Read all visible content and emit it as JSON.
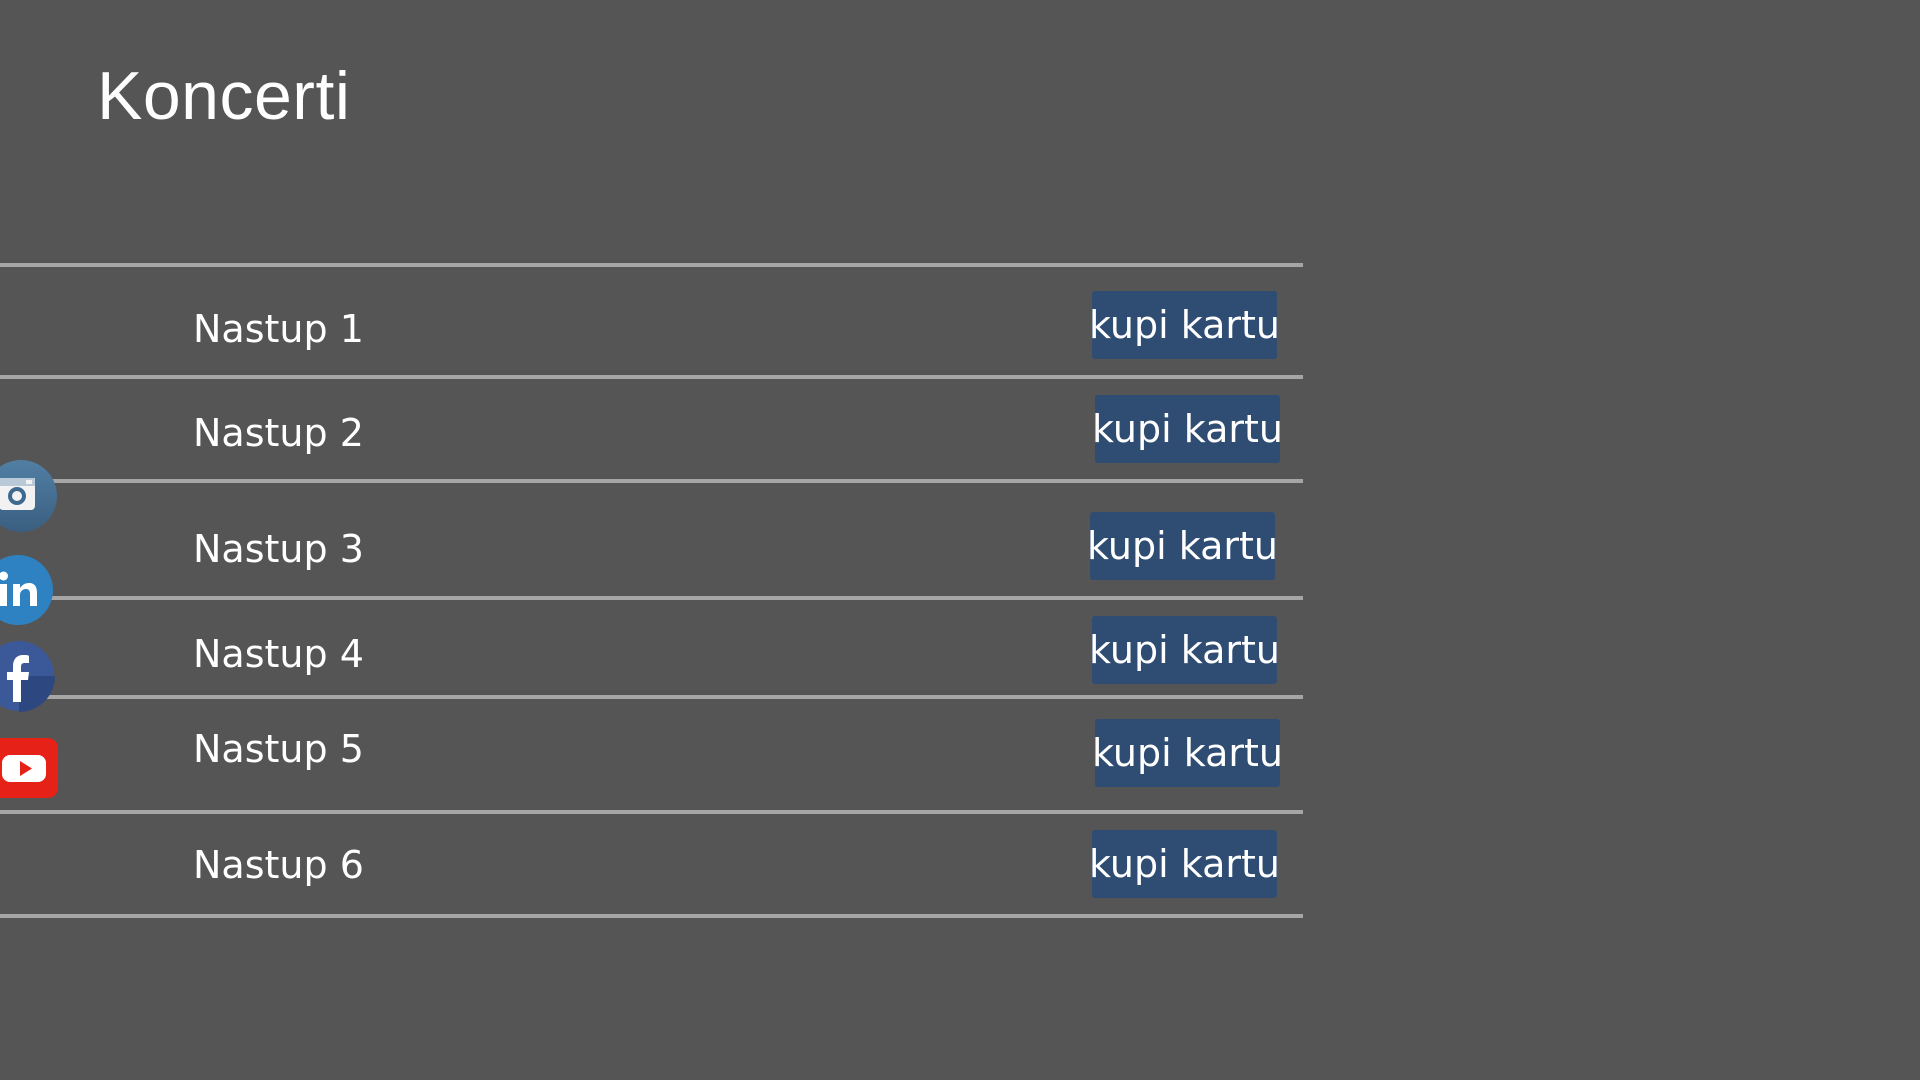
{
  "page": {
    "title": "Koncerti"
  },
  "concerts": [
    {
      "name": "Nastup 1",
      "button_label": "kupi kartu"
    },
    {
      "name": "Nastup 2",
      "button_label": "kupi kartu"
    },
    {
      "name": "Nastup 3",
      "button_label": "kupi kartu"
    },
    {
      "name": "Nastup 4",
      "button_label": "kupi kartu"
    },
    {
      "name": "Nastup 5",
      "button_label": "kupi kartu"
    },
    {
      "name": "Nastup 6",
      "button_label": "kupi kartu"
    }
  ],
  "social": [
    {
      "icon": "instagram-icon",
      "color": "#3f729b"
    },
    {
      "icon": "linkedin-icon",
      "color": "#0e76a8"
    },
    {
      "icon": "facebook-icon",
      "color": "#3b5998"
    },
    {
      "icon": "youtube-icon",
      "color": "#e62117"
    }
  ],
  "colors": {
    "background": "#555555",
    "divider": "#a6a6a6",
    "button": "#2f4c73",
    "text": "#ffffff"
  }
}
